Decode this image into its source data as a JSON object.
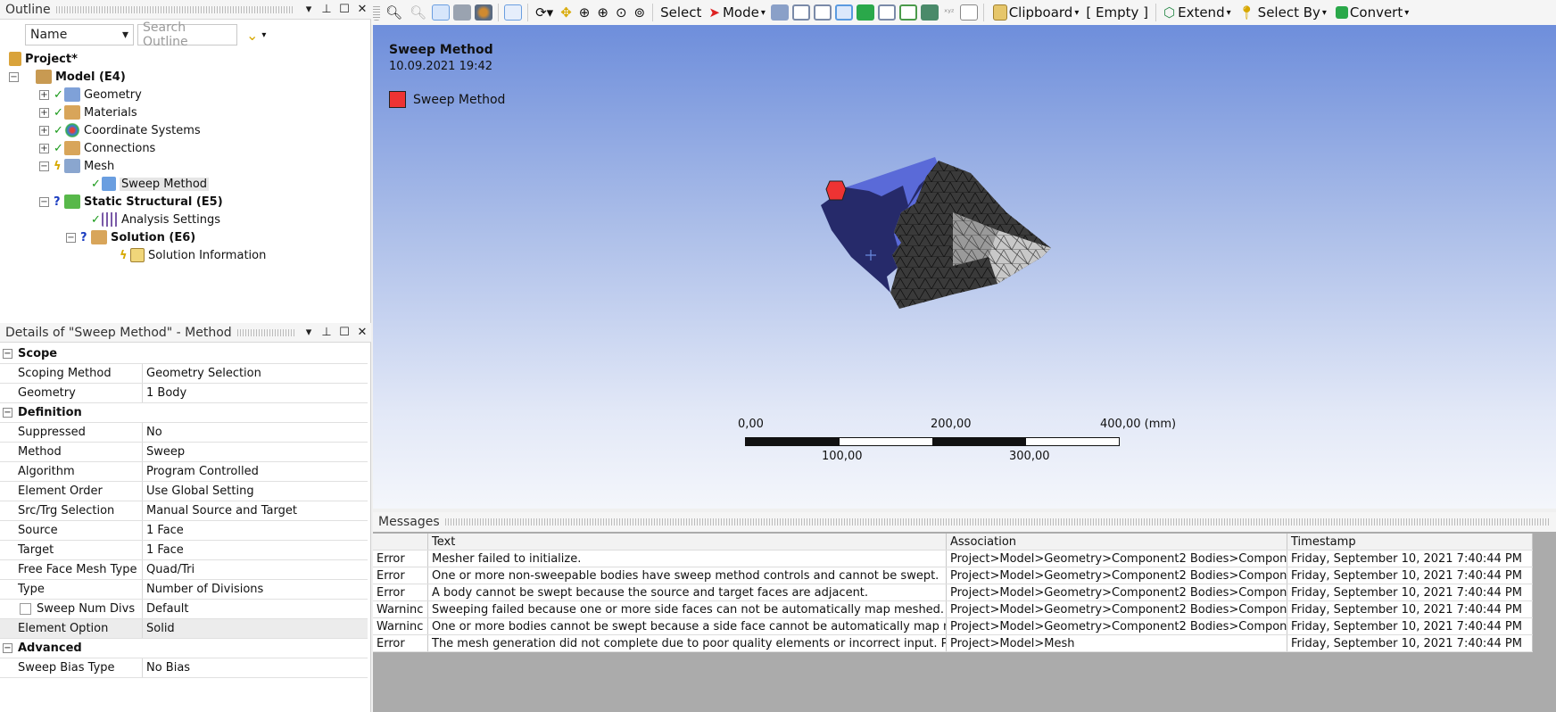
{
  "outline": {
    "title": "Outline",
    "name_combo": "Name",
    "search_placeholder": "Search Outline",
    "tree": [
      {
        "label": "Project*",
        "bold": true
      },
      {
        "label": "Model (E4)",
        "bold": true
      },
      {
        "label": "Geometry"
      },
      {
        "label": "Materials"
      },
      {
        "label": "Coordinate Systems"
      },
      {
        "label": "Connections"
      },
      {
        "label": "Mesh"
      },
      {
        "label": "Sweep Method"
      },
      {
        "label": "Static Structural (E5)",
        "bold": true
      },
      {
        "label": "Analysis Settings"
      },
      {
        "label": "Solution (E6)",
        "bold": true
      },
      {
        "label": "Solution Information"
      }
    ]
  },
  "details": {
    "title": "Details of \"Sweep Method\" - Method",
    "rows": [
      {
        "k": "Scope",
        "cat": true
      },
      {
        "k": "Scoping Method",
        "v": "Geometry Selection"
      },
      {
        "k": "Geometry",
        "v": "1 Body"
      },
      {
        "k": "Definition",
        "cat": true
      },
      {
        "k": "Suppressed",
        "v": "No"
      },
      {
        "k": "Method",
        "v": "Sweep"
      },
      {
        "k": "Algorithm",
        "v": "Program Controlled"
      },
      {
        "k": "Element Order",
        "v": "Use Global Setting"
      },
      {
        "k": "Src/Trg Selection",
        "v": "Manual Source and Target"
      },
      {
        "k": "Source",
        "v": "1 Face"
      },
      {
        "k": "Target",
        "v": "1 Face"
      },
      {
        "k": "Free Face Mesh Type",
        "v": "Quad/Tri"
      },
      {
        "k": "Type",
        "v": "Number of Divisions"
      },
      {
        "k": "Sweep Num Divs",
        "v": "Default"
      },
      {
        "k": "Element Option",
        "v": "Solid"
      },
      {
        "k": "Advanced",
        "cat": true
      },
      {
        "k": "Sweep Bias Type",
        "v": "No Bias"
      }
    ]
  },
  "toolbar": {
    "select": "Select",
    "mode": "Mode",
    "clipboard": "Clipboard",
    "empty": "[ Empty ]",
    "extend": "Extend",
    "select_by": "Select By",
    "convert": "Convert"
  },
  "viewport": {
    "title": "Sweep Method",
    "date": "10.09.2021 19:42",
    "legend": "Sweep Method",
    "scale_labels": [
      "0,00",
      "100,00",
      "200,00",
      "300,00",
      "400,00 (mm)"
    ]
  },
  "messages": {
    "title": "Messages",
    "headers": [
      "",
      "Text",
      "Association",
      "Timestamp"
    ],
    "rows": [
      [
        "Error",
        "Mesher failed to initialize.",
        "Project>Model>Geometry>Component2 Bodies>Compon",
        "Friday, September 10, 2021 7:40:44 PM"
      ],
      [
        "Error",
        "One or more non-sweepable bodies have sweep method controls and cannot be swept.",
        "Project>Model>Geometry>Component2 Bodies>Compon",
        "Friday, September 10, 2021 7:40:44 PM"
      ],
      [
        "Error",
        "A body cannot be swept because the source and target faces are adjacent.",
        "Project>Model>Geometry>Component2 Bodies>Compon",
        "Friday, September 10, 2021 7:40:44 PM"
      ],
      [
        "Warninc",
        "Sweeping failed because one or more side faces can not be automatically map meshed.",
        "Project>Model>Geometry>Component2 Bodies>Compon",
        "Friday, September 10, 2021 7:40:44 PM"
      ],
      [
        "Warninc",
        "One or more bodies cannot be swept because a side face cannot be automatically map m",
        "Project>Model>Geometry>Component2 Bodies>Compon",
        "Friday, September 10, 2021 7:40:44 PM"
      ],
      [
        "Error",
        "The mesh generation did not complete due to poor quality elements or incorrect input. P",
        "Project>Model>Mesh",
        "Friday, September 10, 2021 7:40:44 PM"
      ]
    ]
  },
  "colors": {
    "accent": "#ee3333",
    "viewport_top": "#6e8edb",
    "viewport_bottom": "#f4f6fb"
  }
}
